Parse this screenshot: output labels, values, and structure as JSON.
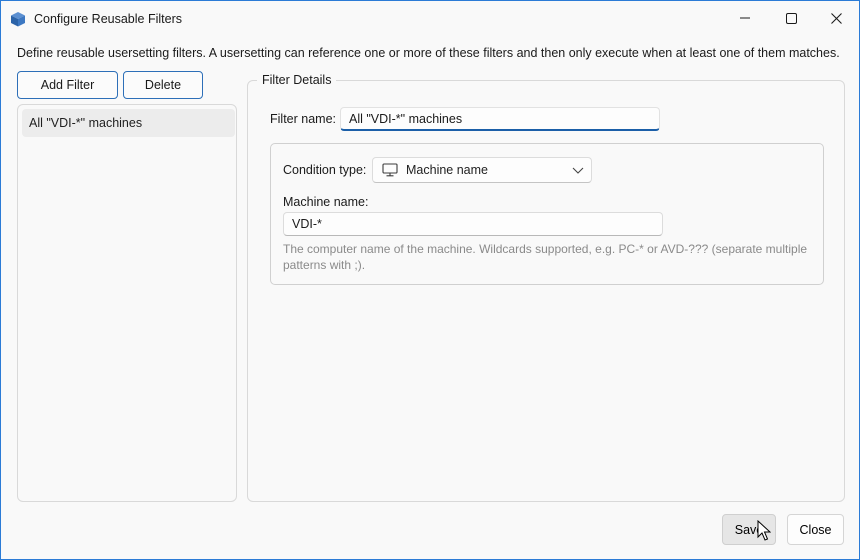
{
  "window": {
    "title": "Configure Reusable Filters",
    "app_icon": "cube-icon",
    "accent": "#2b7bd6",
    "controls": [
      "minimize-icon",
      "maximize-icon",
      "close-icon"
    ]
  },
  "description": "Define reusable usersetting filters. A usersetting can reference one or more of these filters and then only execute when at least one of them matches.",
  "toolbar": {
    "add_label": "Add Filter",
    "delete_label": "Delete"
  },
  "filter_list": {
    "items": [
      {
        "label": "All \"VDI-*\" machines",
        "selected": true
      }
    ]
  },
  "details": {
    "group_title": "Filter Details",
    "filter_name_label": "Filter name:",
    "filter_name_value": "All \"VDI-*\" machines",
    "condition": {
      "type_label": "Condition type:",
      "type_value": "Machine name",
      "type_icon": "monitor-icon",
      "machine_label": "Machine name:",
      "machine_value": "VDI-*",
      "hint": "The computer name of the machine. Wildcards supported, e.g. PC-* or AVD-??? (separate multiple patterns with ;)."
    }
  },
  "footer": {
    "save_label": "Save",
    "close_label": "Close"
  }
}
